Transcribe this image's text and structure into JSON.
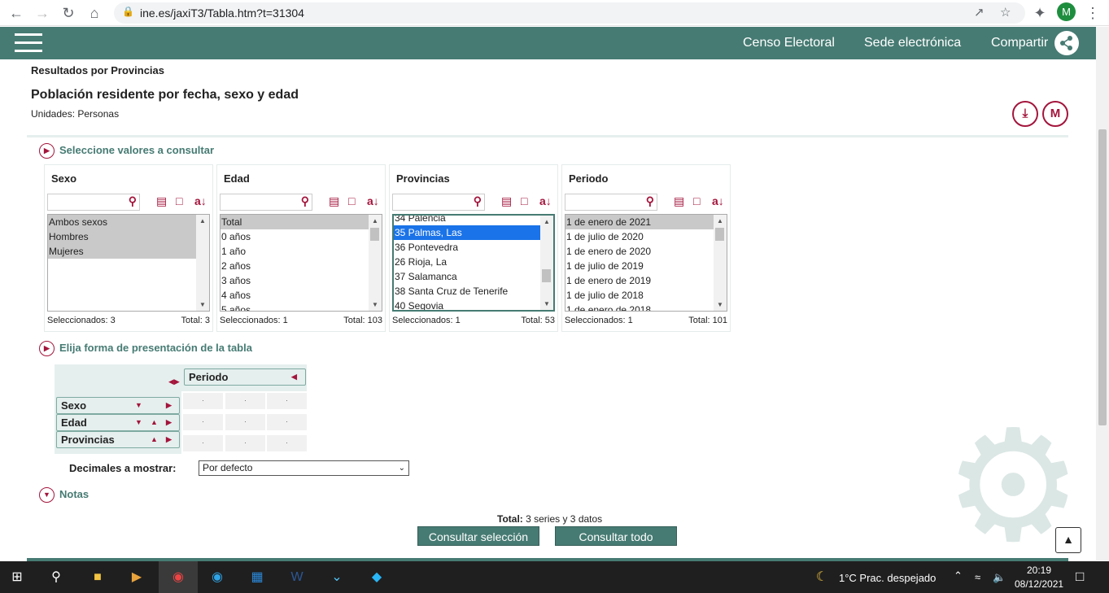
{
  "browser": {
    "url": "ine.es/jaxiT3/Tabla.htm?t=31304",
    "profile_initial": "M"
  },
  "header": {
    "links": [
      "Censo Electoral",
      "Sede electrónica",
      "Compartir"
    ]
  },
  "page": {
    "breadcrumb": "Resultados por Provincias",
    "title": "Población residente por fecha, sexo y edad",
    "units": "Unidades:  Personas",
    "download_icon": "download-icon",
    "mi_icon": "M"
  },
  "select_section": {
    "heading": "Seleccione valores a consultar",
    "panels": [
      {
        "title": "Sexo",
        "items": [
          {
            "label": "Ambos sexos",
            "state": "sel"
          },
          {
            "label": "Hombres",
            "state": "sel"
          },
          {
            "label": "Mujeres",
            "state": "sel"
          }
        ],
        "selected": "Seleccionados: 3",
        "total": "Total: 3",
        "scroll": false
      },
      {
        "title": "Edad",
        "items": [
          {
            "label": "Total",
            "state": "sel"
          },
          {
            "label": "0 años",
            "state": ""
          },
          {
            "label": "1 año",
            "state": ""
          },
          {
            "label": "2 años",
            "state": ""
          },
          {
            "label": "3 años",
            "state": ""
          },
          {
            "label": "4 años",
            "state": ""
          },
          {
            "label": "5 años",
            "state": ""
          }
        ],
        "selected": "Seleccionados: 1",
        "total": "Total: 103",
        "scroll": true
      },
      {
        "title": "Provincias",
        "items": [
          {
            "label": "34 Palencia",
            "state": ""
          },
          {
            "label": "35 Palmas, Las",
            "state": "selblue"
          },
          {
            "label": "36 Pontevedra",
            "state": ""
          },
          {
            "label": "26 Rioja, La",
            "state": ""
          },
          {
            "label": "37 Salamanca",
            "state": ""
          },
          {
            "label": "38 Santa Cruz de Tenerife",
            "state": ""
          },
          {
            "label": "40 Segovia",
            "state": ""
          }
        ],
        "selected": "Seleccionados: 1",
        "total": "Total: 53",
        "scroll": true
      },
      {
        "title": "Periodo",
        "items": [
          {
            "label": "1 de enero de 2021",
            "state": "sel"
          },
          {
            "label": "1 de julio de 2020",
            "state": ""
          },
          {
            "label": "1 de enero de 2020",
            "state": ""
          },
          {
            "label": "1 de julio de 2019",
            "state": ""
          },
          {
            "label": "1 de enero de 2019",
            "state": ""
          },
          {
            "label": "1 de julio de 2018",
            "state": ""
          },
          {
            "label": "1 de enero de 2018",
            "state": ""
          }
        ],
        "selected": "Seleccionados: 1",
        "total": "Total: 101",
        "scroll": true
      }
    ]
  },
  "layout_section": {
    "heading": "Elija forma de presentación de la tabla",
    "column_var": "Periodo",
    "row_vars": [
      "Sexo",
      "Edad",
      "Provincias"
    ],
    "cell_placeholder": "."
  },
  "decimals": {
    "label": "Decimales a mostrar:",
    "value": "Por defecto"
  },
  "notes": {
    "heading": "Notas"
  },
  "summary": {
    "total_label": "Total:",
    "total_text": "3 series y  3 datos"
  },
  "buttons": {
    "consult_selection": "Consultar selección",
    "consult_all": "Consultar todo"
  },
  "taskbar": {
    "weather": "1°C  Prac. despejado",
    "time": "20:19",
    "date": "08/12/2021"
  },
  "colors": {
    "brand": "#467b73",
    "accent": "#a3153c"
  }
}
